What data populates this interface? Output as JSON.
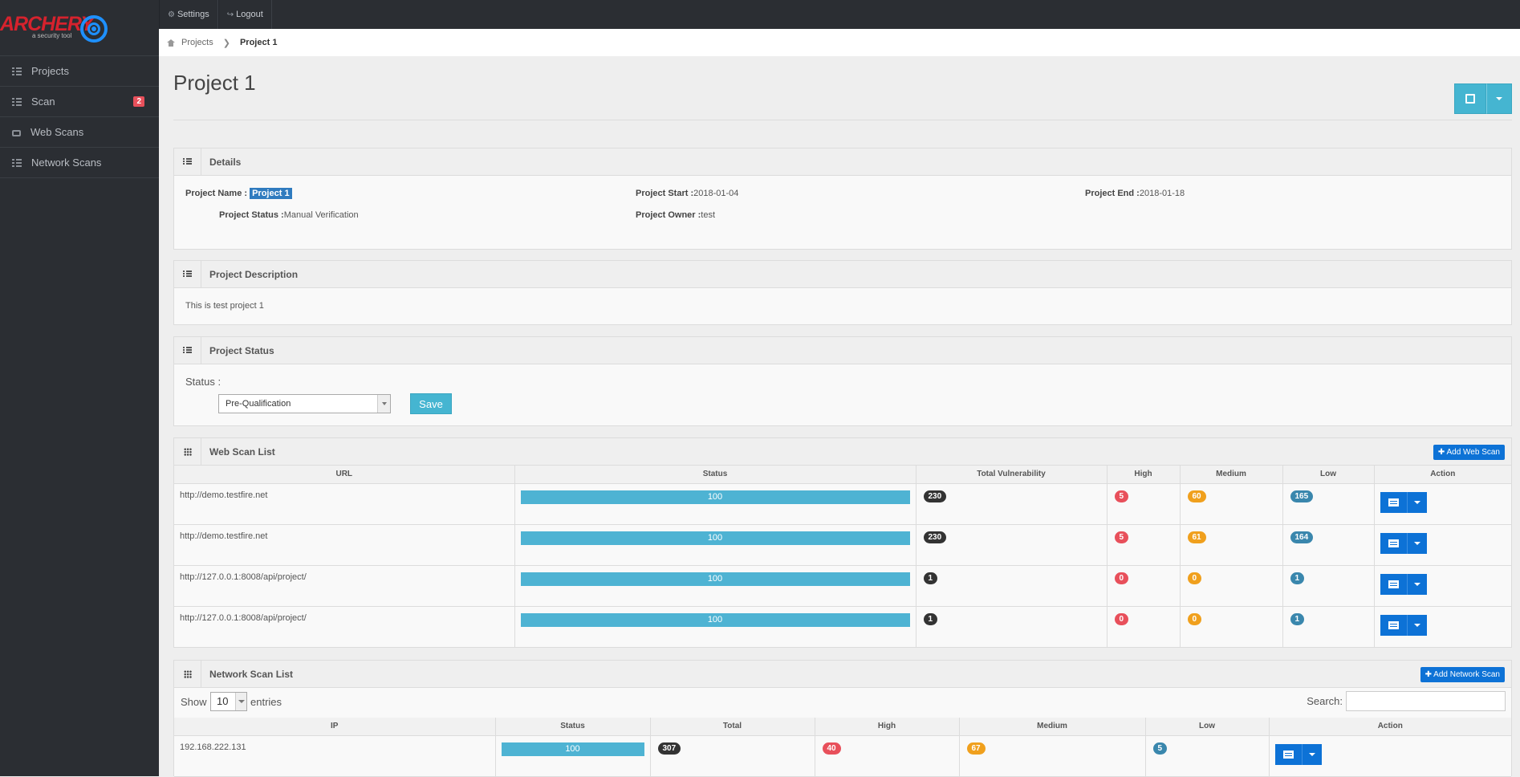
{
  "logo": {
    "name": "ARCHERY",
    "tagline": "a security tool"
  },
  "sidebar": {
    "items": [
      {
        "label": "Projects",
        "icon": "grid-icon"
      },
      {
        "label": "Scan",
        "icon": "grid-icon",
        "badge": "2"
      },
      {
        "label": "Web Scans",
        "icon": "inbox-icon"
      },
      {
        "label": "Network Scans",
        "icon": "grid-icon"
      }
    ]
  },
  "topbar": {
    "settings": "Settings",
    "logout": "Logout"
  },
  "breadcrumb": {
    "root": "Projects",
    "current": "Project 1"
  },
  "page": {
    "title": "Project 1"
  },
  "details": {
    "heading": "Details",
    "project_name_label": "Project Name :",
    "project_name": "Project 1",
    "project_start_label": "Project Start :",
    "project_start": "2018-01-04",
    "project_end_label": "Project End :",
    "project_end": "2018-01-18",
    "project_status_label": "Project Status :",
    "project_status": "Manual Verification",
    "project_owner_label": "Project Owner :",
    "project_owner": "test"
  },
  "description": {
    "heading": "Project Description",
    "text": "This is test project 1"
  },
  "status_panel": {
    "heading": "Project Status",
    "label": "Status :",
    "selected": "Pre-Qualification",
    "save": "Save"
  },
  "web_scans": {
    "heading": "Web Scan List",
    "add_button": "Add Web Scan",
    "columns": [
      "URL",
      "Status",
      "Total Vulnerability",
      "High",
      "Medium",
      "Low",
      "Action"
    ],
    "rows": [
      {
        "url": "http://demo.testfire.net",
        "status": "100",
        "total": "230",
        "high": "5",
        "medium": "60",
        "low": "165"
      },
      {
        "url": "http://demo.testfire.net",
        "status": "100",
        "total": "230",
        "high": "5",
        "medium": "61",
        "low": "164"
      },
      {
        "url": "http://127.0.0.1:8008/api/project/",
        "status": "100",
        "total": "1",
        "high": "0",
        "medium": "0",
        "low": "1"
      },
      {
        "url": "http://127.0.0.1:8008/api/project/",
        "status": "100",
        "total": "1",
        "high": "0",
        "medium": "0",
        "low": "1"
      }
    ]
  },
  "network_scans": {
    "heading": "Network Scan List",
    "add_button": "Add Network Scan",
    "show_label": "Show",
    "entries_value": "10",
    "entries_label": "entries",
    "search_label": "Search:",
    "columns": [
      "IP",
      "Status",
      "Total",
      "High",
      "Medium",
      "Low",
      "Action"
    ],
    "rows": [
      {
        "ip": "192.168.222.131",
        "status": "100",
        "total": "307",
        "high": "40",
        "medium": "67",
        "low": "5"
      }
    ]
  },
  "colors": {
    "accent": "#45b5d1",
    "action": "#0d72d6",
    "high": "#e8505b",
    "medium": "#f0a01d",
    "low": "#3a87ad",
    "sidebar": "#2b2e33"
  }
}
